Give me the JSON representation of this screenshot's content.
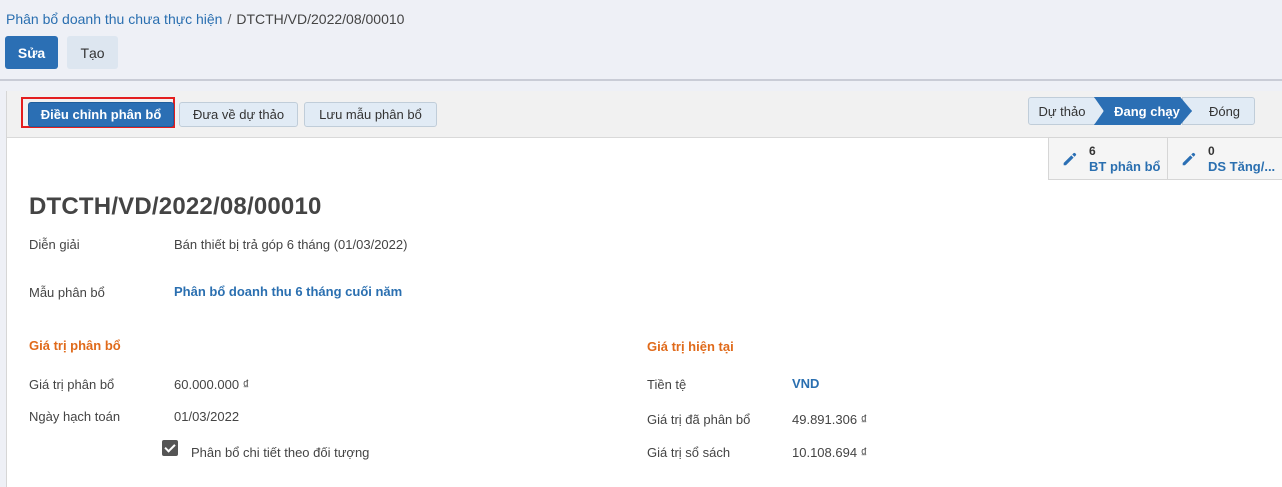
{
  "breadcrumb": {
    "parent": "Phân bổ doanh thu chưa thực hiện",
    "separator": "/",
    "current": "DTCTH/VD/2022/08/00010"
  },
  "toolbar": {
    "edit_label": "Sửa",
    "create_label": "Tạo"
  },
  "statusbar": {
    "adjust_label": "Điều chỉnh phân bổ",
    "draft_label": "Đưa về dự thảo",
    "save_template_label": "Lưu mẫu phân bổ",
    "stages": [
      "Dự thảo",
      "Đang chạy",
      "Đóng"
    ],
    "active_stage": "Đang chạy"
  },
  "smart_buttons": [
    {
      "count": "6",
      "label": "BT phân bổ",
      "icon": "pencil-icon"
    },
    {
      "count": "0",
      "label": "DS Tăng/...",
      "icon": "pencil-icon"
    }
  ],
  "record": {
    "title": "DTCTH/VD/2022/08/00010",
    "description_label": "Diễn giải",
    "description_value": "Bán thiết bị trả góp 6 tháng (01/03/2022)",
    "template_label": "Mẫu phân bổ",
    "template_value": "Phân bổ doanh thu 6 tháng cuối năm"
  },
  "left_section": {
    "heading": "Giá trị phân bổ",
    "amount_label": "Giá trị phân bổ",
    "amount_value": "60.000.000 ₫",
    "date_label": "Ngày hạch toán",
    "date_value": "01/03/2022",
    "detail_checkbox_label": "Phân bổ chi tiết theo đối tượng",
    "detail_checked": true
  },
  "right_section": {
    "heading": "Giá trị hiện tại",
    "currency_label": "Tiền tệ",
    "currency_value": "VND",
    "allocated_label": "Giá trị đã phân bổ",
    "allocated_value": "49.891.306 ₫",
    "book_label": "Giá trị sổ sách",
    "book_value": "10.108.694 ₫"
  },
  "colors": {
    "primary": "#2b6fb4",
    "link": "#2a6fb0",
    "section_heading": "#e06a1a",
    "highlight": "#e41e1e"
  }
}
